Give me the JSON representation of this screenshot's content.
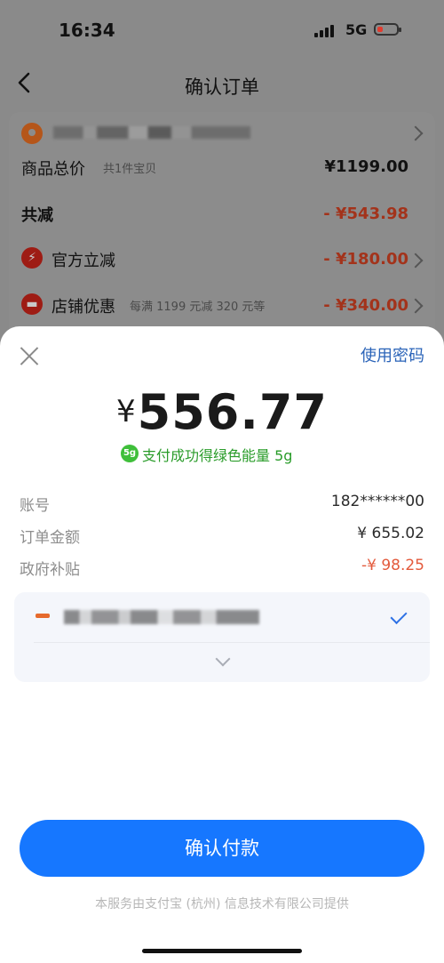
{
  "status_bar": {
    "time": "16:34",
    "network": "5G"
  },
  "nav": {
    "title": "确认订单"
  },
  "order_summary": {
    "total": {
      "label": "商品总价",
      "sub": "共1件宝贝",
      "value": "¥1199.00"
    },
    "reduction": {
      "label": "共减",
      "value": "- ¥543.98"
    },
    "official": {
      "label": "官方立减",
      "value": "- ¥180.00"
    },
    "shop": {
      "label": "店铺优惠",
      "sub": "每满 1199 元减 320 元等",
      "value": "- ¥340.00"
    }
  },
  "sheet": {
    "use_password": "使用密码",
    "currency": "¥",
    "amount": "556.77",
    "green_energy_badge": "5g",
    "green_energy": "支付成功得绿色能量 5g",
    "rows": [
      {
        "label": "账号",
        "value": "182******00"
      },
      {
        "label": "订单金额",
        "value": "¥ 655.02"
      },
      {
        "label": "政府补贴",
        "value": "-¥ 98.25"
      }
    ],
    "confirm_button": "确认付款",
    "footer": "本服务由支付宝 (杭州) 信息技术有限公司提供"
  },
  "colors": {
    "primary": "#1677ff",
    "link": "#2a63b8",
    "discount": "#e35a3c",
    "green": "#2a9c2a"
  },
  "icons": [
    "back-icon",
    "close-icon",
    "check-icon",
    "chevron-down-icon",
    "chevron-right-icon",
    "location-icon",
    "lightning-icon",
    "shop-icon",
    "green-energy-icon",
    "bank-card-icon"
  ]
}
